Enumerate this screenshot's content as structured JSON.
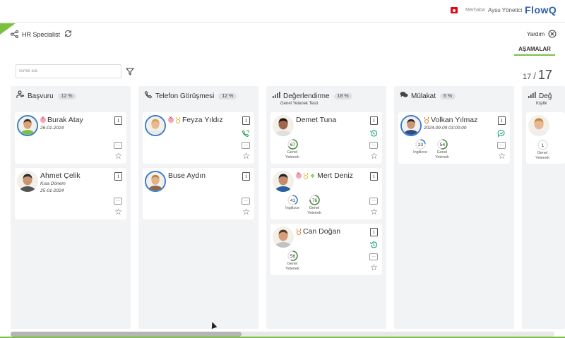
{
  "header": {
    "greeting": "Merhaba",
    "user": "Aysu Yönetici",
    "logo": "FlowQ"
  },
  "subheader": {
    "title": "HR Specialist",
    "help": "Yardım",
    "tab": "AŞAMALAR"
  },
  "search": {
    "placeholder": "İsimle ara"
  },
  "pager": {
    "current": "17",
    "total": "17"
  },
  "colors": {
    "accent": "#7ac142",
    "brand": "#2c5fa8",
    "ring_blue": "#3a7bd5",
    "score_green": "#4a8f3a"
  },
  "columns": [
    {
      "title": "Başvuru",
      "badge": "12 %",
      "icon": "user-hand-icon",
      "cards": [
        {
          "name": "Burak Atay",
          "line1": "26-01-2024",
          "line2": "",
          "badges": [
            "pink-x"
          ],
          "ring": true,
          "skin": "#d9a27a",
          "hair": "#3b2a1e",
          "shirt": "#7ac142"
        },
        {
          "name": "Ahmet Çelik",
          "line1": "Kısa Dönem",
          "line2": "25-01-2024",
          "badges": [],
          "ring": false,
          "skin": "#c99574",
          "hair": "#2a2a2a",
          "shirt": "#555"
        }
      ]
    },
    {
      "title": "Telefon Görüşmesi",
      "badge": "12 %",
      "icon": "phone-icon",
      "cards": [
        {
          "name": "Feyza Yıldız",
          "line1": "",
          "line2": "",
          "badges": [
            "pink-x",
            "gold-medal"
          ],
          "ring": true,
          "skin": "#e8b892",
          "hair": "#d6a24a",
          "shirt": "#e9e9e9"
        },
        {
          "name": "Buse Aydın",
          "line1": "",
          "line2": "",
          "badges": [],
          "ring": true,
          "skin": "#e3b08a",
          "hair": "#b9823a",
          "shirt": "#8a6a4a"
        }
      ]
    },
    {
      "title": "Değerlendirme",
      "badge": "18 %",
      "subtitle": "Genel Yetenek Testi",
      "icon": "bar-chart-icon",
      "cards": [
        {
          "name": "Demet Tuna",
          "badges": [],
          "ring": false,
          "skin": "#a0684a",
          "hair": "#1e1410",
          "shirt": "#e0e0e0",
          "scores": [
            {
              "value": "67",
              "label": "Genel Yetenek"
            }
          ]
        },
        {
          "name": "Mert Deniz",
          "badges": [
            "pink-x",
            "gold-medal",
            "runner"
          ],
          "ring": false,
          "skin": "#c58c6a",
          "hair": "#222",
          "shirt": "#2a5fa0",
          "scores": [
            {
              "value": "41",
              "label": "İngilizce"
            },
            {
              "value": "76",
              "label": "Genel Yetenek"
            }
          ]
        },
        {
          "name": "Can Doğan",
          "badges": [
            "orange-medal"
          ],
          "ring": false,
          "skin": "#d59d7a",
          "hair": "#5a3a22",
          "shirt": "#c2c2c2",
          "scores": [
            {
              "value": "56",
              "label": "Genel Yetenek"
            }
          ]
        }
      ]
    },
    {
      "title": "Mülakat",
      "badge": "6 %",
      "icon": "chat-bubbles-icon",
      "cards": [
        {
          "name": "Volkan Yılmaz",
          "line1": "2024-09-09 03:00:00",
          "badges": [
            "orange-medal"
          ],
          "ring": true,
          "skin": "#c99676",
          "hair": "#2a2a2a",
          "shirt": "#2c4f80",
          "scores": [
            {
              "value": "23",
              "label": "İngilizce"
            },
            {
              "value": "54",
              "label": "Genel Yetenek"
            }
          ]
        }
      ]
    },
    {
      "title": "Değ",
      "badge": "",
      "subtitle": "Kişilik",
      "icon": "bar-chart-icon",
      "cards": [
        {
          "name": "",
          "badges": [],
          "ring": false,
          "skin": "#e8b892",
          "hair": "#c48a3a",
          "shirt": "#eee",
          "scores": [
            {
              "value": "1",
              "label": "Genel Yetenek"
            }
          ]
        }
      ]
    }
  ]
}
